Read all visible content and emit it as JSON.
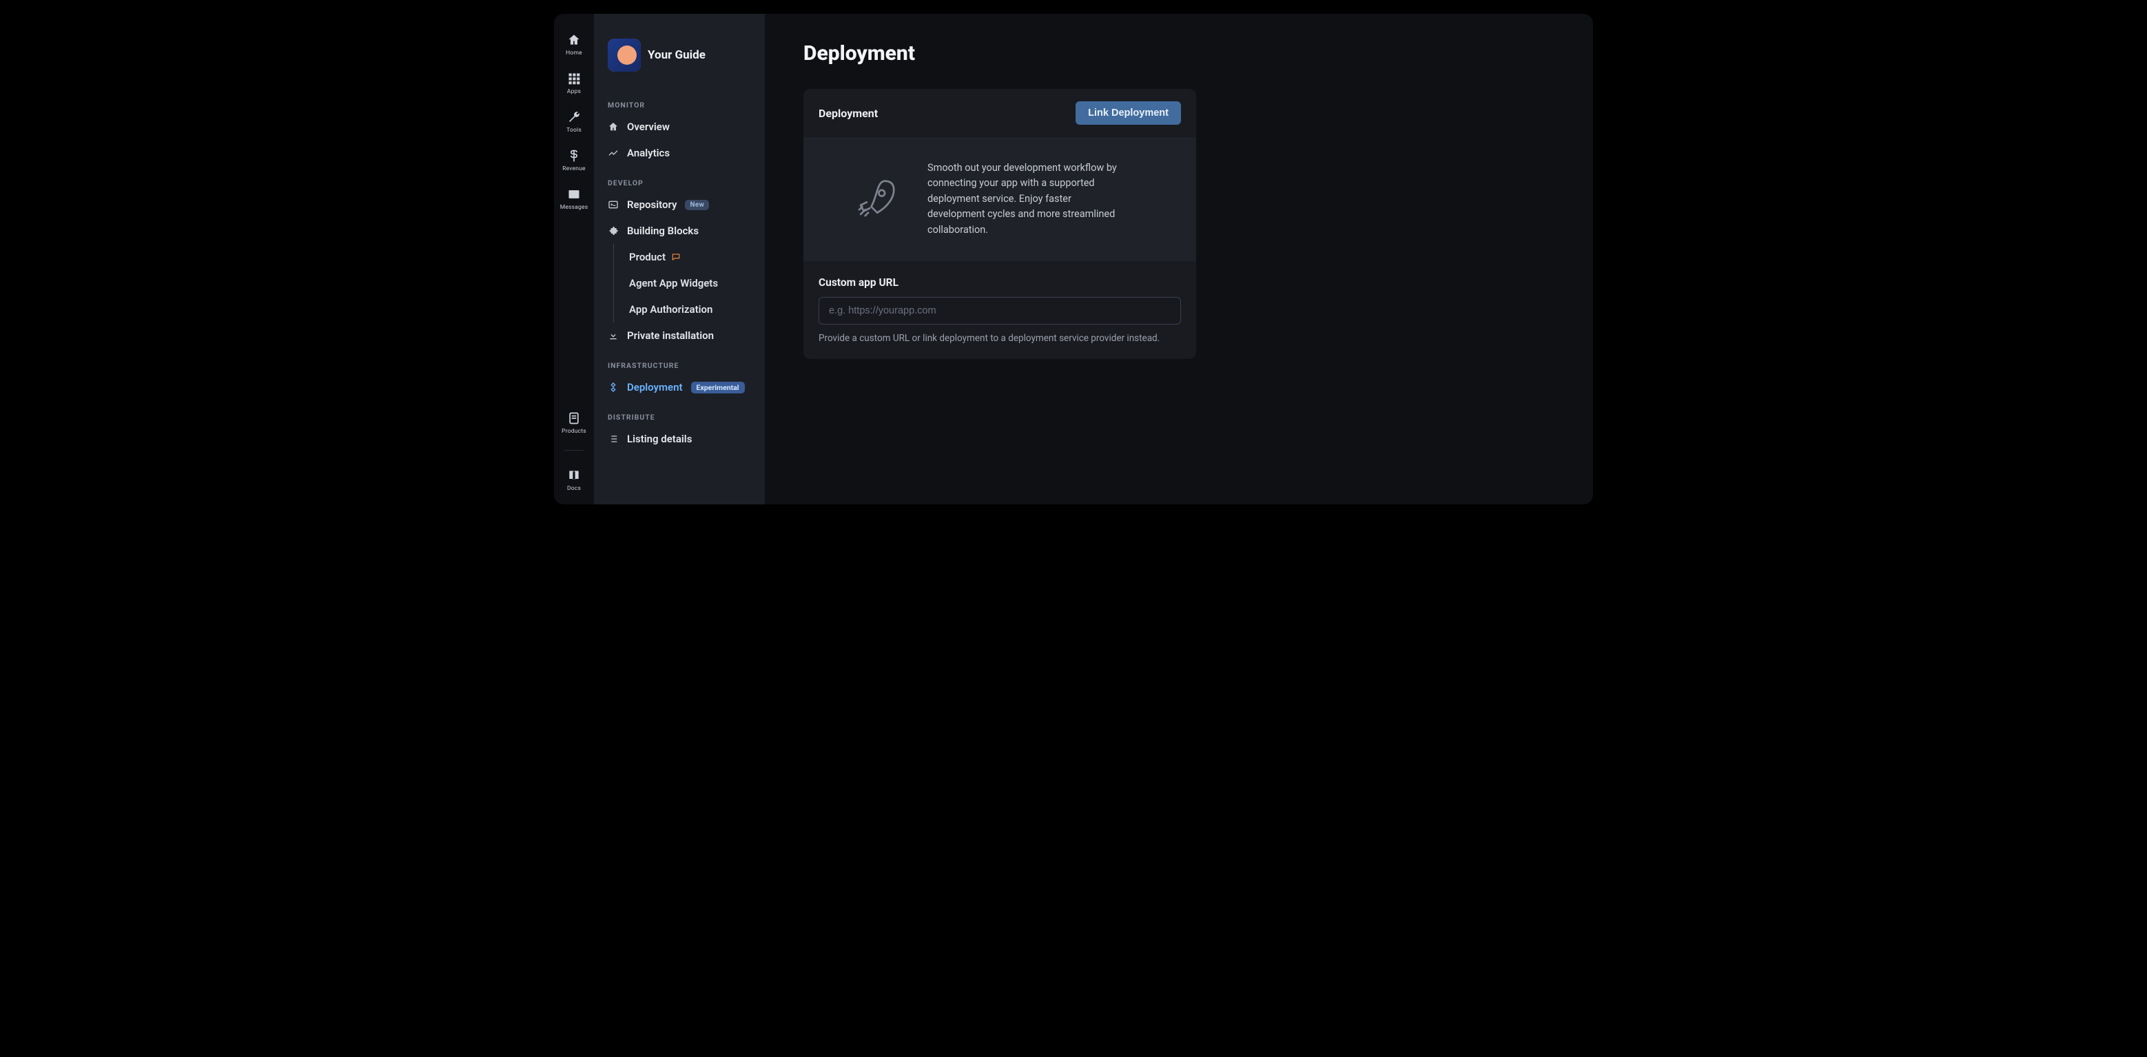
{
  "rail": {
    "top": [
      {
        "label": "Home",
        "icon": "home"
      },
      {
        "label": "Apps",
        "icon": "apps"
      },
      {
        "label": "Tools",
        "icon": "wrench"
      },
      {
        "label": "Revenue",
        "icon": "dollar"
      },
      {
        "label": "Messages",
        "icon": "mail"
      }
    ],
    "bottom": [
      {
        "label": "Products",
        "icon": "sheet"
      },
      {
        "label": "Docs",
        "icon": "book"
      }
    ]
  },
  "app": {
    "title": "Your Guide"
  },
  "sidebar": {
    "sections": [
      {
        "label": "MONITOR",
        "items": [
          {
            "label": "Overview",
            "icon": "home"
          },
          {
            "label": "Analytics",
            "icon": "chart"
          }
        ]
      },
      {
        "label": "DEVELOP",
        "items": [
          {
            "label": "Repository",
            "icon": "terminal",
            "badge": "New"
          },
          {
            "label": "Building Blocks",
            "icon": "puzzle",
            "children": [
              {
                "label": "Product",
                "indicator": "chat"
              },
              {
                "label": "Agent App Widgets"
              },
              {
                "label": "App Authorization"
              }
            ]
          },
          {
            "label": "Private installation",
            "icon": "download"
          }
        ]
      },
      {
        "label": "INFRASTRUCTURE",
        "items": [
          {
            "label": "Deployment",
            "icon": "deploy",
            "badge": "Experimental",
            "active": true
          }
        ]
      },
      {
        "label": "DISTRIBUTE",
        "items": [
          {
            "label": "Listing details",
            "icon": "list"
          }
        ]
      }
    ]
  },
  "page": {
    "title": "Deployment",
    "card_header_title": "Deployment",
    "link_button": "Link Deployment",
    "hero_text": "Smooth out your development workflow by connecting your app with a supported deployment service. Enjoy faster development cycles and more streamlined collaboration.",
    "custom_url_label": "Custom app URL",
    "custom_url_placeholder": "e.g. https://yourapp.com",
    "custom_url_helper": "Provide a custom URL or link deployment to a deployment service provider instead."
  }
}
